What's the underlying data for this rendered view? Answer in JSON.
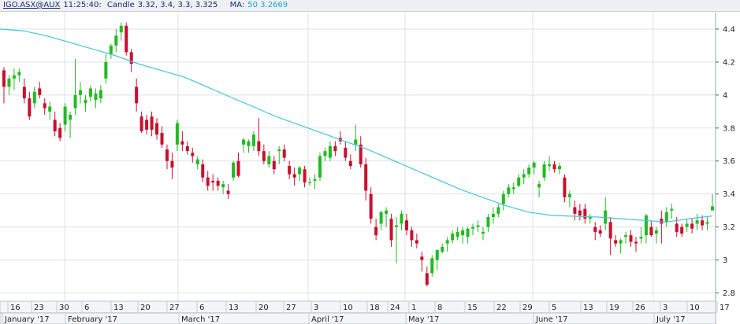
{
  "header": {
    "symbol": "IGO.ASX@AUX",
    "time": "11:25:40:",
    "candle_label": "Candle",
    "candle_values": "3.32, 3.4, 3.3, 3.325",
    "ma_label": "MA:",
    "ma_value": "50 3.2669"
  },
  "expand_icon": "»",
  "colors": {
    "up": "#22bb22",
    "down": "#c8102e",
    "ma": "#42c6dc",
    "grid": "#dde1e8",
    "axis": "#9aa3b0"
  },
  "chart_data": {
    "type": "candlestick",
    "ylim": [
      2.75,
      4.5
    ],
    "yticks": [
      2.8,
      3,
      3.2,
      3.4,
      3.6,
      3.8,
      4,
      4.2,
      4.4
    ],
    "ytick_labels": [
      "2.8",
      "3",
      "3.2",
      "3.4",
      "3.6",
      "3.8",
      "4",
      "4.2",
      "4.4"
    ],
    "xtick_labels": [
      "16",
      "23",
      "30",
      "6",
      "13",
      "20",
      "27",
      "6",
      "13",
      "20",
      "27",
      "3",
      "10",
      "18",
      "24",
      "1",
      "8",
      "15",
      "22",
      "29",
      "5",
      "13",
      "19",
      "26",
      "3",
      "10",
      "17"
    ],
    "month_labels": [
      "January '17",
      "February '17",
      "March '17",
      "April '17",
      "May '17",
      "June '17",
      "July '17"
    ],
    "candles": [
      [
        4.15,
        4.17,
        3.95,
        4.05
      ],
      [
        4.05,
        4.12,
        4.0,
        4.1
      ],
      [
        4.1,
        4.16,
        4.03,
        4.12
      ],
      [
        4.12,
        4.16,
        4.08,
        4.14
      ],
      [
        4.05,
        4.1,
        3.95,
        3.98
      ],
      [
        3.98,
        4.02,
        3.85,
        3.87
      ],
      [
        3.95,
        4.05,
        3.92,
        4.02
      ],
      [
        4.04,
        4.08,
        3.98,
        4.0
      ],
      [
        3.95,
        3.98,
        3.88,
        3.92
      ],
      [
        3.9,
        3.96,
        3.85,
        3.93
      ],
      [
        3.85,
        3.9,
        3.75,
        3.78
      ],
      [
        3.8,
        3.83,
        3.72,
        3.74
      ],
      [
        3.82,
        3.95,
        3.78,
        3.93
      ],
      [
        3.85,
        3.9,
        3.74,
        3.88
      ],
      [
        3.92,
        4.22,
        3.88,
        4.0
      ],
      [
        4.0,
        4.08,
        3.95,
        4.03
      ],
      [
        3.95,
        4.0,
        3.9,
        3.97
      ],
      [
        3.99,
        4.06,
        3.96,
        4.04
      ],
      [
        3.97,
        4.04,
        3.92,
        4.01
      ],
      [
        3.98,
        4.06,
        3.95,
        4.03
      ],
      [
        4.1,
        4.25,
        4.07,
        4.2
      ],
      [
        4.25,
        4.31,
        4.22,
        4.3
      ],
      [
        4.3,
        4.4,
        4.26,
        4.36
      ],
      [
        4.38,
        4.44,
        4.33,
        4.42
      ],
      [
        4.42,
        4.44,
        4.24,
        4.26
      ],
      [
        4.26,
        4.28,
        4.14,
        4.19
      ],
      [
        4.05,
        4.1,
        3.9,
        3.95
      ],
      [
        3.87,
        3.9,
        3.77,
        3.78
      ],
      [
        3.85,
        3.88,
        3.76,
        3.79
      ],
      [
        3.87,
        3.9,
        3.75,
        3.79
      ],
      [
        3.83,
        3.86,
        3.73,
        3.76
      ],
      [
        3.77,
        3.81,
        3.68,
        3.7
      ],
      [
        3.67,
        3.7,
        3.55,
        3.6
      ],
      [
        3.6,
        3.65,
        3.49,
        3.56
      ],
      [
        3.7,
        3.85,
        3.66,
        3.83
      ],
      [
        3.72,
        3.78,
        3.66,
        3.7
      ],
      [
        3.69,
        3.72,
        3.64,
        3.66
      ],
      [
        3.65,
        3.68,
        3.59,
        3.63
      ],
      [
        3.58,
        3.63,
        3.55,
        3.61
      ],
      [
        3.58,
        3.61,
        3.47,
        3.5
      ],
      [
        3.5,
        3.54,
        3.42,
        3.45
      ],
      [
        3.48,
        3.52,
        3.42,
        3.47
      ],
      [
        3.48,
        3.5,
        3.42,
        3.45
      ],
      [
        3.44,
        3.48,
        3.4,
        3.46
      ],
      [
        3.42,
        3.46,
        3.37,
        3.4
      ],
      [
        3.5,
        3.6,
        3.48,
        3.59
      ],
      [
        3.6,
        3.65,
        3.5,
        3.51
      ],
      [
        3.7,
        3.74,
        3.65,
        3.73
      ],
      [
        3.69,
        3.73,
        3.65,
        3.72
      ],
      [
        3.69,
        3.78,
        3.66,
        3.76
      ],
      [
        3.72,
        3.86,
        3.63,
        3.66
      ],
      [
        3.66,
        3.7,
        3.58,
        3.6
      ],
      [
        3.58,
        3.66,
        3.56,
        3.63
      ],
      [
        3.6,
        3.63,
        3.52,
        3.55
      ],
      [
        3.66,
        3.69,
        3.58,
        3.67
      ],
      [
        3.67,
        3.7,
        3.6,
        3.62
      ],
      [
        3.57,
        3.6,
        3.49,
        3.52
      ],
      [
        3.52,
        3.56,
        3.45,
        3.5
      ],
      [
        3.52,
        3.57,
        3.48,
        3.56
      ],
      [
        3.55,
        3.57,
        3.44,
        3.47
      ],
      [
        3.47,
        3.5,
        3.45,
        3.47
      ],
      [
        3.48,
        3.52,
        3.43,
        3.49
      ],
      [
        3.5,
        3.65,
        3.48,
        3.63
      ],
      [
        3.63,
        3.68,
        3.6,
        3.66
      ],
      [
        3.62,
        3.72,
        3.6,
        3.69
      ],
      [
        3.69,
        3.72,
        3.63,
        3.66
      ],
      [
        3.74,
        3.78,
        3.7,
        3.72
      ],
      [
        3.68,
        3.72,
        3.6,
        3.62
      ],
      [
        3.6,
        3.64,
        3.55,
        3.57
      ],
      [
        3.7,
        3.82,
        3.66,
        3.73
      ],
      [
        3.7,
        3.75,
        3.56,
        3.58
      ],
      [
        3.58,
        3.62,
        3.36,
        3.42
      ],
      [
        3.4,
        3.44,
        3.22,
        3.25
      ],
      [
        3.2,
        3.25,
        3.12,
        3.15
      ],
      [
        3.22,
        3.3,
        3.18,
        3.29
      ],
      [
        3.28,
        3.32,
        3.2,
        3.3
      ],
      [
        3.25,
        3.28,
        3.08,
        3.12
      ],
      [
        3.2,
        3.26,
        2.98,
        3.21
      ],
      [
        3.22,
        3.3,
        3.18,
        3.28
      ],
      [
        3.24,
        3.28,
        3.15,
        3.18
      ],
      [
        3.18,
        3.2,
        3.08,
        3.12
      ],
      [
        3.12,
        3.16,
        3.07,
        3.1
      ],
      [
        3.02,
        3.05,
        2.93,
        3.0
      ],
      [
        2.92,
        2.96,
        2.84,
        2.85
      ],
      [
        2.92,
        3.03,
        2.9,
        3.01
      ],
      [
        3.0,
        3.05,
        2.94,
        3.06
      ],
      [
        3.05,
        3.1,
        3.04,
        3.08
      ],
      [
        3.1,
        3.14,
        3.05,
        3.12
      ],
      [
        3.12,
        3.18,
        3.1,
        3.16
      ],
      [
        3.14,
        3.2,
        3.12,
        3.17
      ],
      [
        3.15,
        3.2,
        3.1,
        3.18
      ],
      [
        3.14,
        3.2,
        3.1,
        3.19
      ],
      [
        3.19,
        3.22,
        3.15,
        3.2
      ],
      [
        3.2,
        3.24,
        3.17,
        3.21
      ],
      [
        3.16,
        3.2,
        3.12,
        3.17
      ],
      [
        3.2,
        3.28,
        3.17,
        3.26
      ],
      [
        3.26,
        3.32,
        3.22,
        3.28
      ],
      [
        3.28,
        3.34,
        3.26,
        3.32
      ],
      [
        3.34,
        3.42,
        3.3,
        3.4
      ],
      [
        3.4,
        3.46,
        3.38,
        3.44
      ],
      [
        3.43,
        3.47,
        3.4,
        3.44
      ],
      [
        3.45,
        3.52,
        3.44,
        3.5
      ],
      [
        3.5,
        3.55,
        3.46,
        3.52
      ],
      [
        3.52,
        3.58,
        3.5,
        3.56
      ],
      [
        3.56,
        3.6,
        3.52,
        3.59
      ],
      [
        3.44,
        3.48,
        3.38,
        3.46
      ],
      [
        3.5,
        3.6,
        3.48,
        3.58
      ],
      [
        3.57,
        3.63,
        3.54,
        3.58
      ],
      [
        3.58,
        3.6,
        3.53,
        3.55
      ],
      [
        3.55,
        3.59,
        3.52,
        3.57
      ],
      [
        3.5,
        3.52,
        3.35,
        3.38
      ],
      [
        3.38,
        3.42,
        3.32,
        3.4
      ],
      [
        3.32,
        3.36,
        3.24,
        3.28
      ],
      [
        3.3,
        3.34,
        3.24,
        3.27
      ],
      [
        3.31,
        3.34,
        3.22,
        3.25
      ],
      [
        3.25,
        3.28,
        3.22,
        3.26
      ],
      [
        3.2,
        3.23,
        3.12,
        3.17
      ],
      [
        3.18,
        3.21,
        3.14,
        3.16
      ],
      [
        3.22,
        3.38,
        3.18,
        3.3
      ],
      [
        3.23,
        3.26,
        3.03,
        3.13
      ],
      [
        3.12,
        3.15,
        3.08,
        3.1
      ],
      [
        3.1,
        3.13,
        3.04,
        3.12
      ],
      [
        3.14,
        3.17,
        3.1,
        3.15
      ],
      [
        3.15,
        3.18,
        3.08,
        3.11
      ],
      [
        3.11,
        3.14,
        3.05,
        3.1
      ],
      [
        3.13,
        3.2,
        3.1,
        3.14
      ],
      [
        3.15,
        3.28,
        3.1,
        3.27
      ],
      [
        3.2,
        3.24,
        3.14,
        3.15
      ],
      [
        3.16,
        3.2,
        3.1,
        3.18
      ],
      [
        3.25,
        3.3,
        3.1,
        3.22
      ],
      [
        3.23,
        3.32,
        3.2,
        3.29
      ],
      [
        3.3,
        3.34,
        3.25,
        3.31
      ],
      [
        3.22,
        3.26,
        3.14,
        3.17
      ],
      [
        3.2,
        3.22,
        3.14,
        3.16
      ],
      [
        3.2,
        3.25,
        3.17,
        3.22
      ],
      [
        3.22,
        3.25,
        3.16,
        3.19
      ],
      [
        3.22,
        3.28,
        3.18,
        3.24
      ],
      [
        3.24,
        3.27,
        3.18,
        3.21
      ],
      [
        3.22,
        3.26,
        3.18,
        3.23
      ],
      [
        3.3,
        3.4,
        3.3,
        3.325
      ]
    ],
    "ma_period": 50,
    "ma": [
      4.4,
      4.39,
      4.36,
      4.32,
      4.28,
      4.24,
      4.19,
      4.15,
      4.11,
      4.05,
      3.99,
      3.93,
      3.87,
      3.82,
      3.77,
      3.72,
      3.67,
      3.61,
      3.55,
      3.49,
      3.43,
      3.38,
      3.33,
      3.29,
      3.27,
      3.265,
      3.26,
      3.25,
      3.24,
      3.23,
      3.25,
      3.2669
    ]
  }
}
